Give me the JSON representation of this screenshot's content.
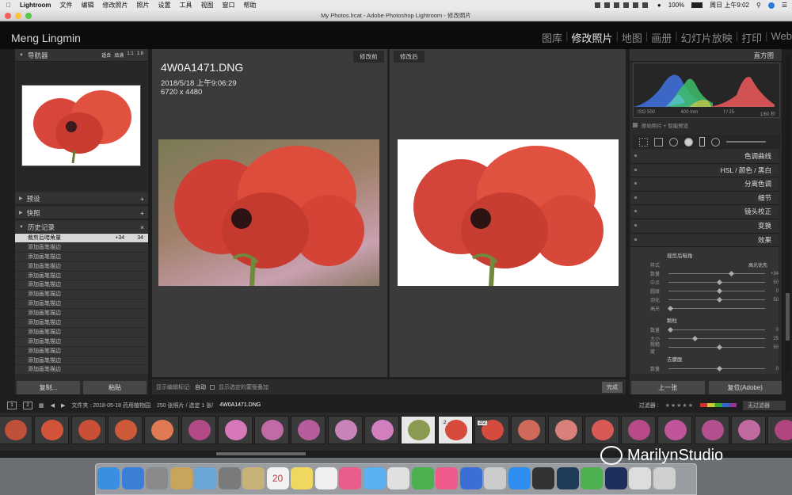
{
  "menubar": {
    "apple_icon": "apple-icon",
    "app": "Lightroom",
    "items": [
      "文件",
      "编辑",
      "修改照片",
      "照片",
      "设置",
      "工具",
      "视图",
      "窗口",
      "帮助"
    ],
    "battery": "100%",
    "clock": "周日 上午9:02"
  },
  "window_title": "My Photos.lrcat - Adobe Photoshop Lightroom - 修改照片",
  "identity_plate": "Meng Lingmin",
  "modules": {
    "library": "图库",
    "develop": "修改照片",
    "map": "地图",
    "book": "画册",
    "slideshow": "幻灯片放映",
    "print": "打印",
    "web": "Web"
  },
  "left": {
    "navigator": "导航器",
    "nav_zoom": [
      "适合",
      "填满",
      "1:1",
      "1:8"
    ],
    "presets": "预设",
    "snapshots": "快照",
    "history": "历史记录",
    "history_items": [
      {
        "label": "裁剪后暗角量",
        "v1": "+34",
        "v2": "34"
      },
      {
        "label": "添加画笔描边"
      },
      {
        "label": "添加画笔描边"
      },
      {
        "label": "添加画笔描边"
      },
      {
        "label": "添加画笔描边"
      },
      {
        "label": "添加画笔描边"
      },
      {
        "label": "添加画笔描边"
      },
      {
        "label": "添加画笔描边"
      },
      {
        "label": "添加画笔描边"
      },
      {
        "label": "添加画笔描边"
      },
      {
        "label": "添加画笔描边"
      },
      {
        "label": "添加画笔描边"
      },
      {
        "label": "添加画笔描边"
      },
      {
        "label": "添加画笔描边"
      },
      {
        "label": "添加画笔描边"
      }
    ],
    "copy": "复制...",
    "paste": "粘贴"
  },
  "center": {
    "before": "修改前",
    "after": "修改后",
    "filename": "4W0A1471.DNG",
    "datetime": "2018/5/18 上午9:06:29",
    "dimensions": "6720 x 4480",
    "toolbar_show": "显示编辑标记:",
    "toolbar_auto": "自动",
    "toolbar_overlay": "显示选定的蒙版叠加",
    "done": "完成"
  },
  "right": {
    "histogram": "直方图",
    "iso": "ISO 500",
    "focal": "400 mm",
    "aperture": "f / 25",
    "shutter": "1/60 秒",
    "smart_preview": "原始照片 + 智能预览",
    "sections": [
      "色调曲线",
      "HSL / 颜色 / 黑白",
      "分离色调",
      "细节",
      "镜头校正",
      "变换",
      "效果"
    ],
    "vignette_title": "裁剪后暗角",
    "style_label": "样式",
    "style_value": "高光优先",
    "vignette": [
      {
        "label": "数量",
        "value": "+34",
        "pos": 0.62
      },
      {
        "label": "中点",
        "value": "50",
        "pos": 0.5
      },
      {
        "label": "圆度",
        "value": "0",
        "pos": 0.5
      },
      {
        "label": "羽化",
        "value": "50",
        "pos": 0.5
      },
      {
        "label": "高光",
        "value": "",
        "pos": 0.0
      }
    ],
    "grain_title": "颗粒",
    "grain": [
      {
        "label": "数量",
        "value": "0",
        "pos": 0.0
      },
      {
        "label": "大小",
        "value": "25",
        "pos": 0.25
      },
      {
        "label": "粗糙度",
        "value": "50",
        "pos": 0.5
      }
    ],
    "dehaze_title": "去朦胧",
    "dehaze": [
      {
        "label": "数量",
        "value": "0",
        "pos": 0.5
      }
    ],
    "prev": "上一张",
    "reset": "复位(Adobe)"
  },
  "filmstrip": {
    "source": "文件夹 : 2018-05-18 药用植物园",
    "count": "250 张照片 / 选定 1 张/",
    "current": "4W0A1471.DNG",
    "filter_label": "过滤器 :",
    "filter_value": "无过滤器",
    "badge1": "2",
    "badge2": "2/2"
  },
  "colors": {
    "accent": "#e8e8e8",
    "panel": "#2b2b2b",
    "center_bg": "#3b3b3b"
  },
  "watermark": "MarilynStudio",
  "dock_icons": [
    "finder-icon",
    "safari-icon",
    "launchpad-icon",
    "photos-folder-icon",
    "preview-icon",
    "system-prefs-icon",
    "notes-icon",
    "calendar-icon",
    "stickies-icon",
    "reminders-icon",
    "photos-icon",
    "messages-icon",
    "textedit-icon",
    "numbers-icon",
    "music-icon",
    "keynote-icon",
    "preview2-icon",
    "appstore-icon",
    "camera-icon",
    "lightroom-icon",
    "wechat-icon",
    "photoshop-icon",
    "documents-icon",
    "trash-icon"
  ],
  "dock_badge": "20"
}
